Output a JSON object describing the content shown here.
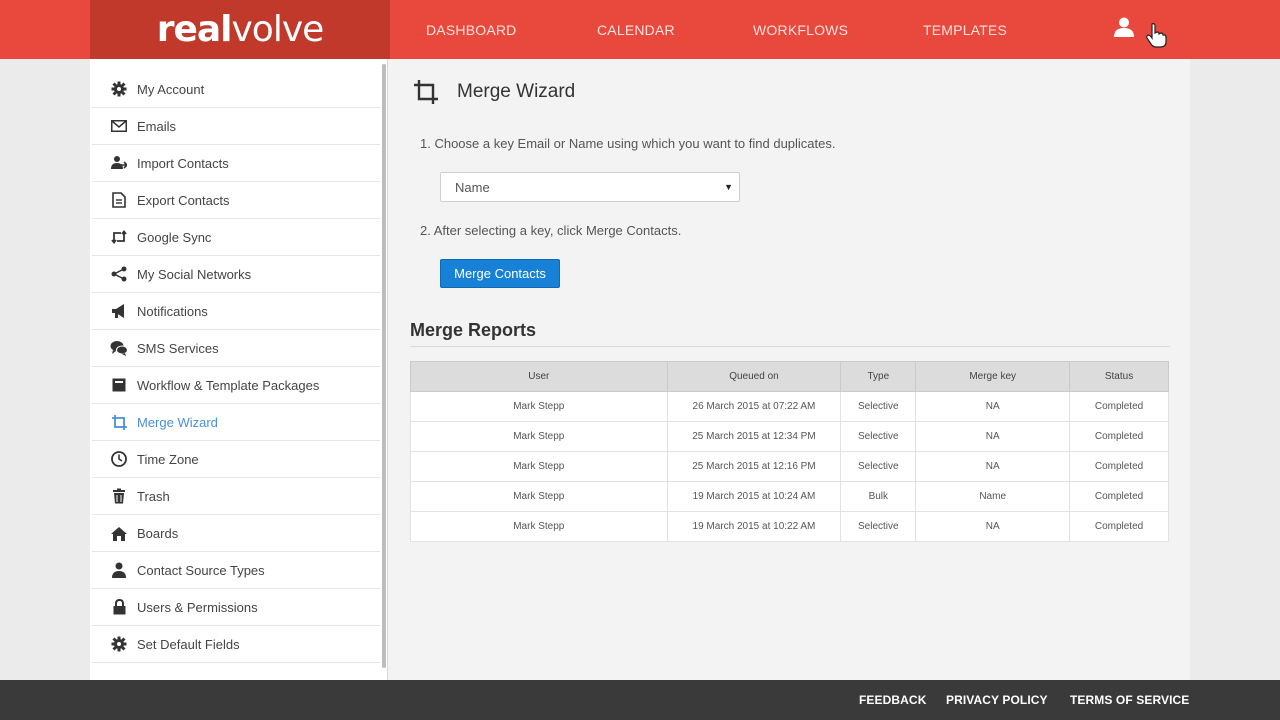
{
  "header": {
    "logo_bold": "real",
    "logo_light": "volve",
    "nav": [
      "DASHBOARD",
      "CALENDAR",
      "WORKFLOWS",
      "TEMPLATES"
    ]
  },
  "sidebar": {
    "items": [
      {
        "label": "My Account",
        "icon": "gear-icon"
      },
      {
        "label": "Emails",
        "icon": "envelope-icon"
      },
      {
        "label": "Import Contacts",
        "icon": "users-import-icon"
      },
      {
        "label": "Export Contacts",
        "icon": "document-icon"
      },
      {
        "label": "Google Sync",
        "icon": "retweet-icon"
      },
      {
        "label": "My Social Networks",
        "icon": "share-icon"
      },
      {
        "label": "Notifications",
        "icon": "megaphone-icon"
      },
      {
        "label": "SMS Services",
        "icon": "chat-bubbles-icon"
      },
      {
        "label": "Workflow & Template Packages",
        "icon": "box-icon"
      },
      {
        "label": "Merge Wizard",
        "icon": "crop-icon"
      },
      {
        "label": "Time Zone",
        "icon": "clock-icon"
      },
      {
        "label": "Trash",
        "icon": "trash-icon"
      },
      {
        "label": "Boards",
        "icon": "home-icon"
      },
      {
        "label": "Contact Source Types",
        "icon": "person-icon"
      },
      {
        "label": "Users & Permissions",
        "icon": "lock-icon"
      },
      {
        "label": "Set Default Fields",
        "icon": "gear-icon"
      }
    ],
    "active_index": 9
  },
  "main": {
    "title": "Merge Wizard",
    "step1": "1. Choose a key Email or Name using which you want to find duplicates.",
    "select_value": "Name",
    "step2": "2. After selecting a key, click Merge Contacts.",
    "merge_button": "Merge Contacts",
    "reports_title": "Merge Reports",
    "columns": [
      "User",
      "Queued on",
      "Type",
      "Merge key",
      "Status"
    ],
    "rows": [
      [
        "Mark Stepp",
        "26 March 2015 at 07:22 AM",
        "Selective",
        "NA",
        "Completed"
      ],
      [
        "Mark Stepp",
        "25 March 2015 at 12:34 PM",
        "Selective",
        "NA",
        "Completed"
      ],
      [
        "Mark Stepp",
        "25 March 2015 at 12:16 PM",
        "Selective",
        "NA",
        "Completed"
      ],
      [
        "Mark Stepp",
        "19 March 2015 at 10:24 AM",
        "Bulk",
        "Name",
        "Completed"
      ],
      [
        "Mark Stepp",
        "19 March 2015 at 10:22 AM",
        "Selective",
        "NA",
        "Completed"
      ]
    ]
  },
  "footer": {
    "links": [
      "FEEDBACK",
      "PRIVACY POLICY",
      "TERMS OF SERVICE"
    ]
  },
  "colors": {
    "header_red": "#e9493c",
    "logo_red": "#c0392b",
    "button_blue": "#1681d6",
    "active_link": "#4a8fd6"
  }
}
